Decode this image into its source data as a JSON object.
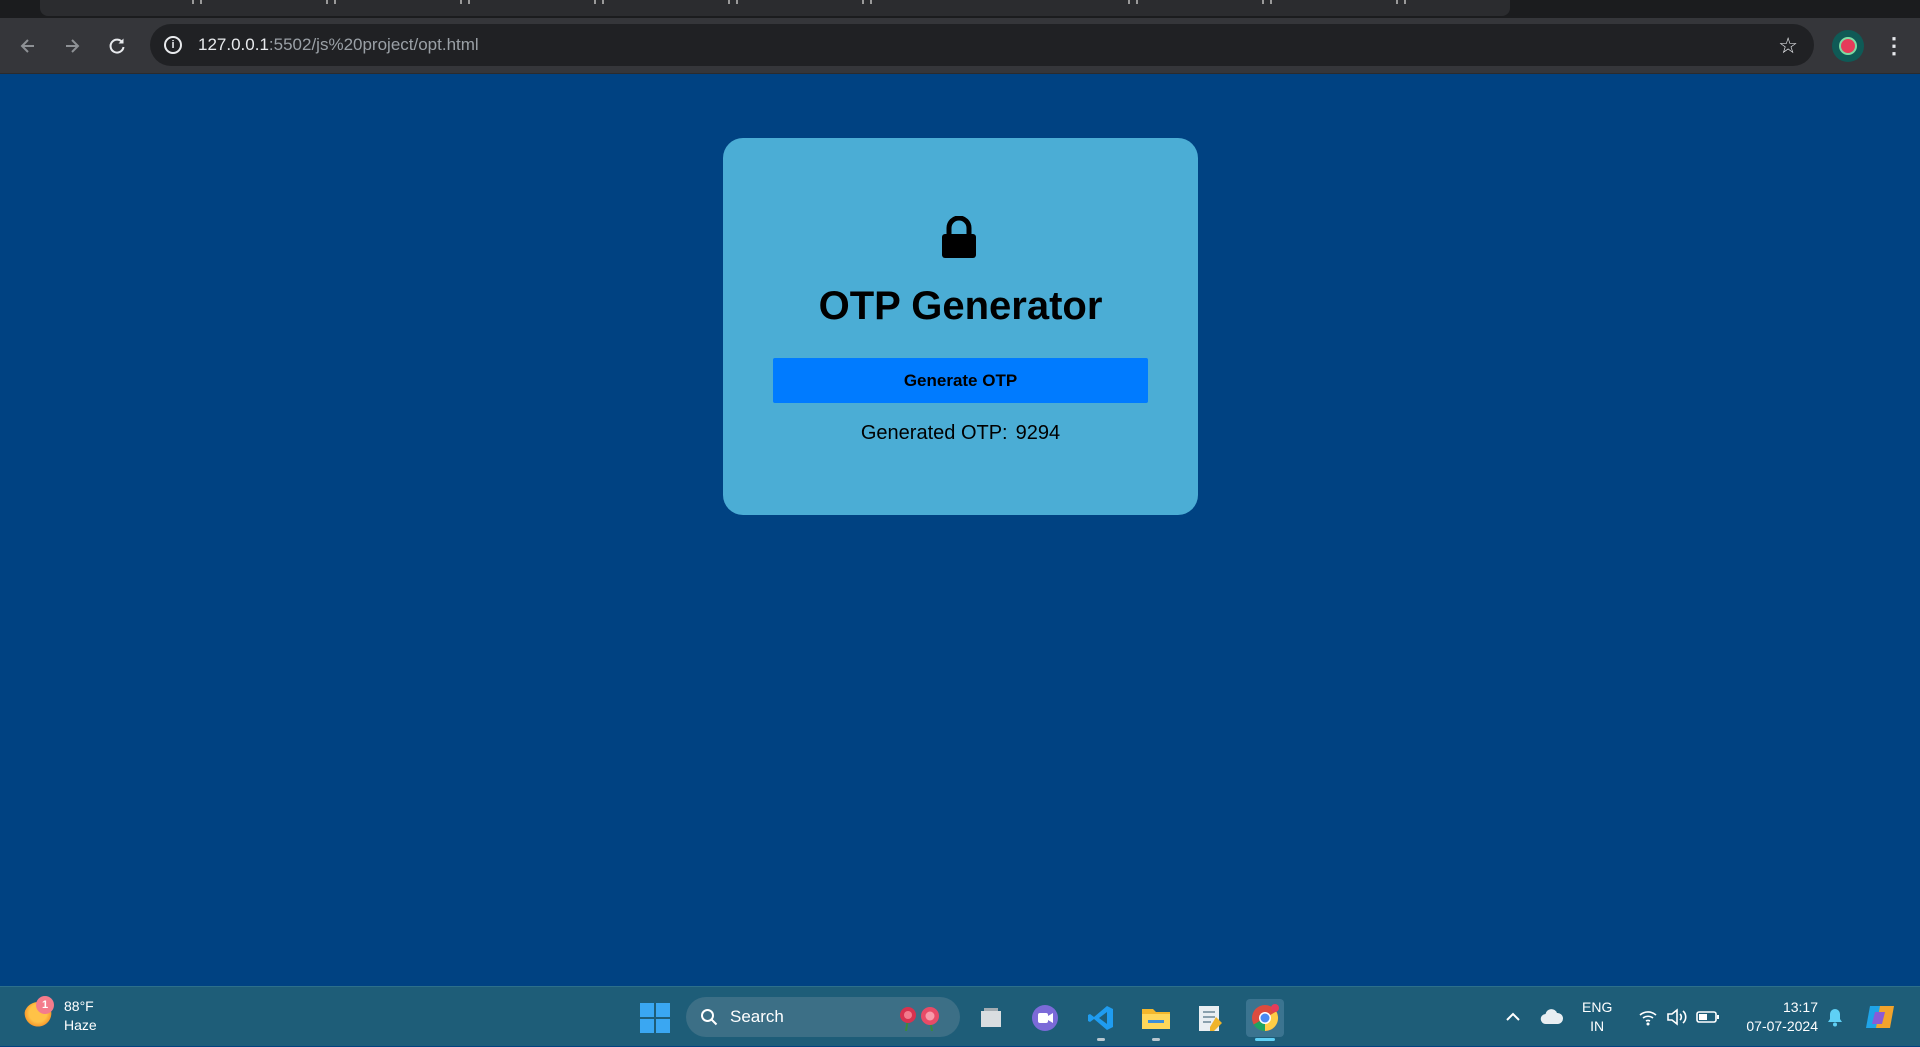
{
  "browser": {
    "url_host": "127.0.0.1",
    "url_path": ":5502/js%20project/opt.html"
  },
  "page": {
    "title": "OTP Generator",
    "button_label": "Generate OTP",
    "otp_label": "Generated OTP:",
    "otp_value": "9294"
  },
  "colors": {
    "page_background": "#004282",
    "card_background": "#4badd5",
    "button_background": "#007bff"
  },
  "taskbar": {
    "weather_badge": "1",
    "weather_temp": "88°F",
    "weather_cond": "Haze",
    "search_label": "Search",
    "lang_line1": "ENG",
    "lang_line2": "IN",
    "time": "13:17",
    "date": "07-07-2024"
  }
}
